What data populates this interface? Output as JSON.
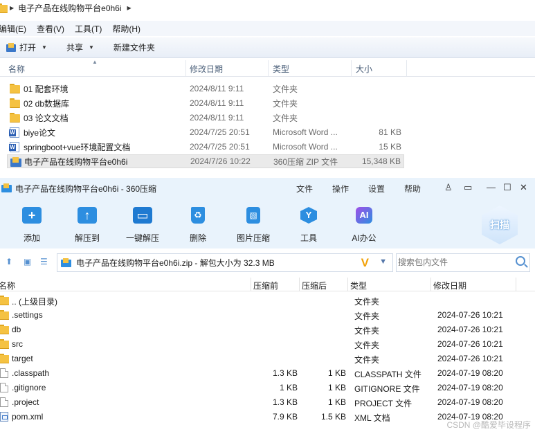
{
  "explorer": {
    "address": "电子产品在线购物平台e0h6i",
    "menu": [
      "编辑(E)",
      "查看(V)",
      "工具(T)",
      "帮助(H)"
    ],
    "toolbar": {
      "open": "打开",
      "share": "共享",
      "new_folder": "新建文件夹"
    },
    "columns": {
      "name": "名称",
      "date": "修改日期",
      "type": "类型",
      "size": "大小"
    },
    "files": [
      {
        "name": "01 配套环境",
        "date": "2024/8/11 9:11",
        "type": "文件夹",
        "size": "",
        "icon": "folder-icon"
      },
      {
        "name": "02 db数据库",
        "date": "2024/8/11 9:11",
        "type": "文件夹",
        "size": "",
        "icon": "folder-icon"
      },
      {
        "name": "03 论文文档",
        "date": "2024/8/11 9:11",
        "type": "文件夹",
        "size": "",
        "icon": "folder-icon"
      },
      {
        "name": "biye论文",
        "date": "2024/7/25 20:51",
        "type": "Microsoft Word ...",
        "size": "81 KB",
        "icon": "word-icon"
      },
      {
        "name": "springboot+vue环境配置文档",
        "date": "2024/7/25 20:51",
        "type": "Microsoft Word ...",
        "size": "15 KB",
        "icon": "word-icon"
      },
      {
        "name": "电子产品在线购物平台e0h6i",
        "date": "2024/7/26 10:22",
        "type": "360压缩 ZIP 文件",
        "size": "15,348 KB",
        "icon": "zip-icon"
      }
    ]
  },
  "zip_app": {
    "title": "电子产品在线购物平台e0h6i - 360压缩",
    "menu": [
      "文件",
      "操作",
      "设置",
      "帮助"
    ],
    "ribbon": [
      "添加",
      "解压到",
      "一键解压",
      "删除",
      "图片压缩",
      "工具",
      "AI办公"
    ],
    "scan_label": "扫描",
    "ai_badge": "AI",
    "path": "电子产品在线购物平台e0h6i.zip - 解包大小为 32.3 MB",
    "search_placeholder": "搜索包内文件",
    "columns": {
      "name": "名称",
      "compressed_before": "压缩前",
      "compressed_after": "压缩后",
      "type": "类型",
      "date": "修改日期"
    },
    "entries": [
      {
        "name": ".. (上级目录)",
        "before": "",
        "after": "",
        "type": "文件夹",
        "date": "",
        "icon": "folder-icon"
      },
      {
        "name": ".settings",
        "before": "",
        "after": "",
        "type": "文件夹",
        "date": "2024-07-26 10:21",
        "icon": "folder-icon"
      },
      {
        "name": "db",
        "before": "",
        "after": "",
        "type": "文件夹",
        "date": "2024-07-26 10:21",
        "icon": "folder-icon"
      },
      {
        "name": "src",
        "before": "",
        "after": "",
        "type": "文件夹",
        "date": "2024-07-26 10:21",
        "icon": "folder-icon"
      },
      {
        "name": "target",
        "before": "",
        "after": "",
        "type": "文件夹",
        "date": "2024-07-26 10:21",
        "icon": "folder-icon"
      },
      {
        "name": ".classpath",
        "before": "1.3 KB",
        "after": "1 KB",
        "type": "CLASSPATH 文件",
        "date": "2024-07-19 08:20",
        "icon": "file-icon"
      },
      {
        "name": ".gitignore",
        "before": "1 KB",
        "after": "1 KB",
        "type": "GITIGNORE 文件",
        "date": "2024-07-19 08:20",
        "icon": "file-icon"
      },
      {
        "name": ".project",
        "before": "1.3 KB",
        "after": "1 KB",
        "type": "PROJECT 文件",
        "date": "2024-07-19 08:20",
        "icon": "file-icon"
      },
      {
        "name": "pom.xml",
        "before": "7.9 KB",
        "after": "1.5 KB",
        "type": "XML 文档",
        "date": "2024-07-19 08:20",
        "icon": "xml-icon"
      }
    ]
  },
  "watermark": "CSDN @酷爱毕设程序"
}
